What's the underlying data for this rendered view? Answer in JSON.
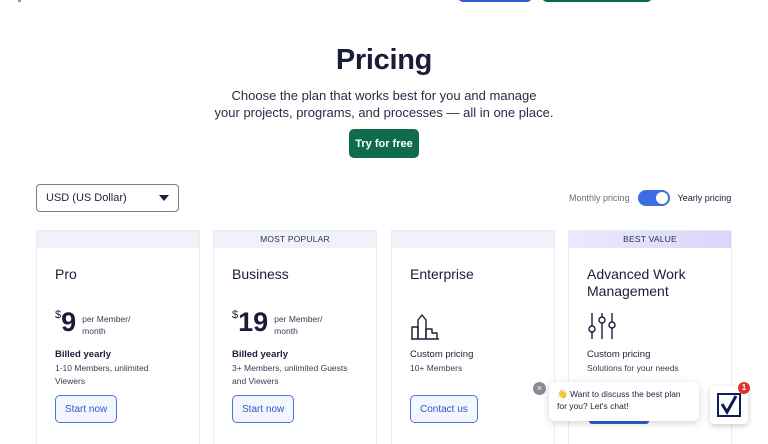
{
  "hero": {
    "title": "Pricing",
    "subtitle_line1": "Choose the plan that works best for you and manage",
    "subtitle_line2": "your projects, programs, and processes — all in one place.",
    "cta_label": "Try for free"
  },
  "currency": {
    "selected": "USD (US Dollar)"
  },
  "billing_toggle": {
    "monthly_label": "Monthly pricing",
    "yearly_label": "Yearly pricing",
    "yearly_selected": true
  },
  "plans": [
    {
      "banner": "",
      "name": "Pro",
      "currency_symbol": "$",
      "price": "9",
      "per_line1": "per Member/",
      "per_line2": "month",
      "billing": "Billed yearly",
      "desc_line1": "1-10 Members, unlimited",
      "desc_line2": "Viewers",
      "cta": "Start now"
    },
    {
      "banner": "MOST POPULAR",
      "name": "Business",
      "currency_symbol": "$",
      "price": "19",
      "per_line1": "per Member/",
      "per_line2": "month",
      "billing": "Billed yearly",
      "desc_line1": "3+ Members, unlimited Guests",
      "desc_line2": "and Viewers",
      "cta": "Start now"
    },
    {
      "banner": "",
      "name": "Enterprise",
      "icon": "building-icon",
      "billing": "Custom pricing",
      "desc_line1": "10+ Members",
      "cta": "Contact us"
    },
    {
      "banner": "BEST VALUE",
      "name_line1": "Advanced Work",
      "name_line2": "Management",
      "icon": "sliders-icon",
      "billing": "Custom pricing",
      "desc_line1": "Solutions for your needs"
    }
  ],
  "chat": {
    "message_line1": "👋 Want to discuss the best plan",
    "message_line2": "for you? Let's chat!",
    "badge_count": "1",
    "close_glyph": "×"
  },
  "colors": {
    "primary_green": "#0e6b4d",
    "accent_blue": "#3d6de4",
    "text_dark": "#1b1c3a"
  }
}
